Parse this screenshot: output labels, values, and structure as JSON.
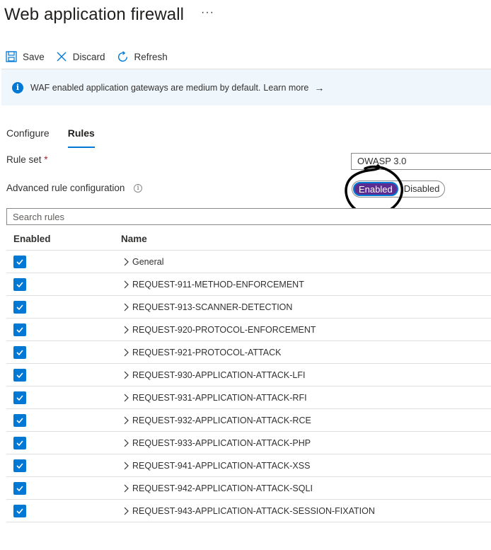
{
  "header": {
    "title": "Web application firewall",
    "more": "···"
  },
  "toolbar": {
    "save": "Save",
    "discard": "Discard",
    "refresh": "Refresh"
  },
  "banner": {
    "text": "WAF enabled application gateways are medium by default.",
    "link": "Learn more",
    "arrow": "→",
    "info_glyph": "i"
  },
  "tabs": [
    {
      "label": "Configure"
    },
    {
      "label": "Rules"
    }
  ],
  "ruleset": {
    "label": "Rule set",
    "required": "*",
    "value": "OWASP 3.0"
  },
  "advanced": {
    "label": "Advanced rule configuration",
    "info_glyph": "i",
    "enabled_label": "Enabled",
    "disabled_label": "Disabled",
    "selected": "Enabled"
  },
  "search": {
    "placeholder": "Search rules"
  },
  "table": {
    "headers": {
      "enabled": "Enabled",
      "name": "Name"
    },
    "rows": [
      {
        "name": "General",
        "checked": true
      },
      {
        "name": "REQUEST-911-METHOD-ENFORCEMENT",
        "checked": true
      },
      {
        "name": "REQUEST-913-SCANNER-DETECTION",
        "checked": true
      },
      {
        "name": "REQUEST-920-PROTOCOL-ENFORCEMENT",
        "checked": true
      },
      {
        "name": "REQUEST-921-PROTOCOL-ATTACK",
        "checked": true
      },
      {
        "name": "REQUEST-930-APPLICATION-ATTACK-LFI",
        "checked": true
      },
      {
        "name": "REQUEST-931-APPLICATION-ATTACK-RFI",
        "checked": true
      },
      {
        "name": "REQUEST-932-APPLICATION-ATTACK-RCE",
        "checked": true
      },
      {
        "name": "REQUEST-933-APPLICATION-ATTACK-PHP",
        "checked": true
      },
      {
        "name": "REQUEST-941-APPLICATION-ATTACK-XSS",
        "checked": true
      },
      {
        "name": "REQUEST-942-APPLICATION-ATTACK-SQLI",
        "checked": true
      },
      {
        "name": "REQUEST-943-APPLICATION-ATTACK-SESSION-FIXATION",
        "checked": true
      }
    ]
  },
  "colors": {
    "accent": "#0078d4",
    "toggle_on": "#5c2d91",
    "banner_bg": "#eff6fc",
    "annotation": "#000000"
  },
  "icons": {
    "save": "save-icon",
    "discard": "close-icon",
    "refresh": "refresh-icon",
    "info": "info-icon",
    "expand": "chevron-right-icon",
    "check": "checkmark-icon"
  }
}
